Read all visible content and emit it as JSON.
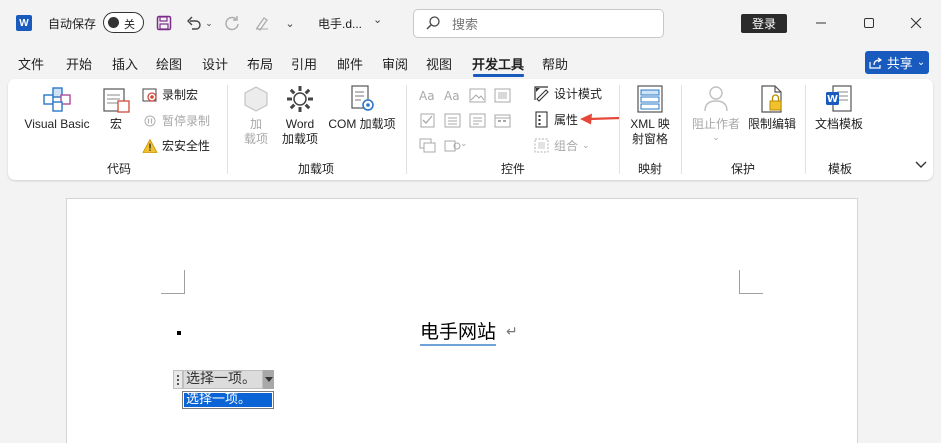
{
  "titlebar": {
    "autosave_label": "自动保存",
    "autosave_state": "关",
    "doc_title": "电手.d...",
    "search_placeholder": "搜索",
    "login_label": "登录"
  },
  "tabs": [
    {
      "label": "文件",
      "active": false
    },
    {
      "label": "开始",
      "active": false
    },
    {
      "label": "插入",
      "active": false
    },
    {
      "label": "绘图",
      "active": false
    },
    {
      "label": "设计",
      "active": false
    },
    {
      "label": "布局",
      "active": false
    },
    {
      "label": "引用",
      "active": false
    },
    {
      "label": "邮件",
      "active": false
    },
    {
      "label": "审阅",
      "active": false
    },
    {
      "label": "视图",
      "active": false
    },
    {
      "label": "开发工具",
      "active": true
    },
    {
      "label": "帮助",
      "active": false
    }
  ],
  "share_label": "共享",
  "ribbon": {
    "code": {
      "group_label": "代码",
      "visual_basic": "Visual Basic",
      "macros": "宏",
      "record_macro": "录制宏",
      "pause_recording": "暂停录制",
      "macro_security": "宏安全性"
    },
    "addins": {
      "group_label": "加载项",
      "addins_line1": "加",
      "addins_line2": "载项",
      "word_addins_line1": "Word",
      "word_addins_line2": "加载项",
      "com_addins": "COM 加载项"
    },
    "controls": {
      "group_label": "控件",
      "design_mode": "设计模式",
      "properties": "属性",
      "group": "组合"
    },
    "mapping": {
      "group_label": "映射",
      "xml_line1": "XML 映",
      "xml_line2": "射窗格"
    },
    "protect": {
      "group_label": "保护",
      "block_authors": "阻止作者",
      "restrict_editing": "限制编辑"
    },
    "templates": {
      "group_label": "模板",
      "document_template": "文档模板"
    }
  },
  "document": {
    "heading": "电手网站",
    "content_control_text": "选择一项。",
    "dropdown_options": [
      "选择一项。"
    ]
  },
  "colors": {
    "accent": "#185abd",
    "annotation_arrow": "#e5483a",
    "selection": "#0a64d6"
  }
}
